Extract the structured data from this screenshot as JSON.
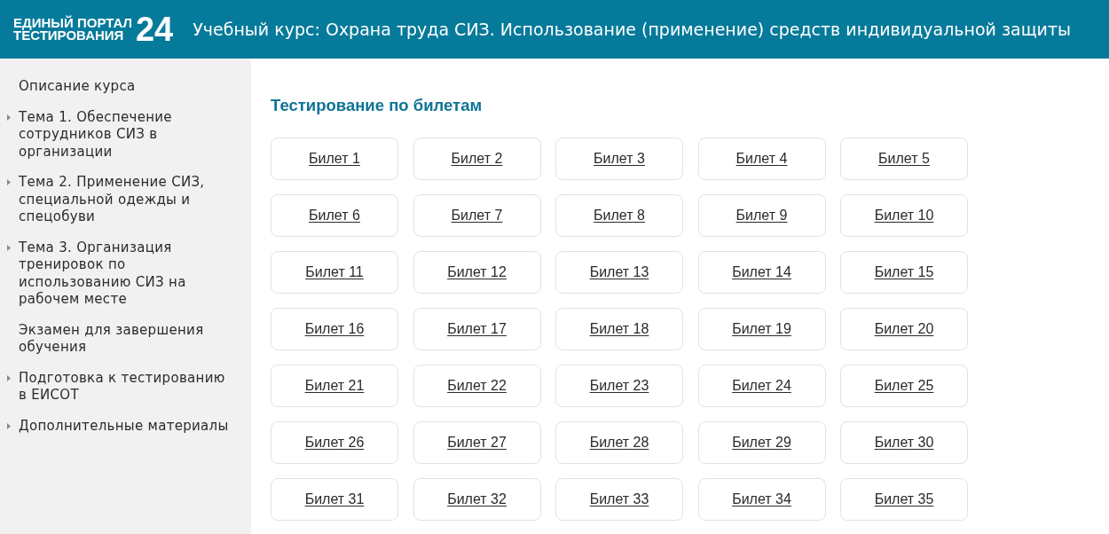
{
  "header": {
    "logo": {
      "line_1": "ЕДИНЫЙ ПОРТАЛ",
      "line_2": "ТЕСТИРОВАНИЯ",
      "number": "24"
    },
    "title": "Учебный курс: Охрана труда СИЗ. Использование (применение) средств индивидуальной защиты"
  },
  "sidebar": {
    "items": [
      {
        "kind": "link",
        "label": "Описание курса"
      },
      {
        "kind": "section",
        "label": "Тема 1. Обеспечение сотрудников СИЗ в организации"
      },
      {
        "kind": "section",
        "label": "Тема 2. Применение СИЗ, специальной одежды и спецобуви"
      },
      {
        "kind": "section",
        "label": "Тема 3. Организация тренировок по использованию СИЗ на рабочем месте"
      },
      {
        "kind": "link",
        "label": "Экзамен для завершения обучения"
      },
      {
        "kind": "section",
        "label": "Подготовка к тестированию в ЕИСОТ"
      },
      {
        "kind": "section",
        "label": "Дополнительные материалы"
      }
    ]
  },
  "main": {
    "heading": "Тестирование по билетам",
    "tickets": [
      "Билет 1",
      "Билет 2",
      "Билет 3",
      "Билет 4",
      "Билет 5",
      "Билет 6",
      "Билет 7",
      "Билет 8",
      "Билет 9",
      "Билет 10",
      "Билет 11",
      "Билет 12",
      "Билет 13",
      "Билет 14",
      "Билет 15",
      "Билет 16",
      "Билет 17",
      "Билет 18",
      "Билет 19",
      "Билет 20",
      "Билет 21",
      "Билет 22",
      "Билет 23",
      "Билет 24",
      "Билет 25",
      "Билет 26",
      "Билет 27",
      "Билет 28",
      "Билет 29",
      "Билет 30",
      "Билет 31",
      "Билет 32",
      "Билет 33",
      "Билет 34",
      "Билет 35"
    ]
  }
}
